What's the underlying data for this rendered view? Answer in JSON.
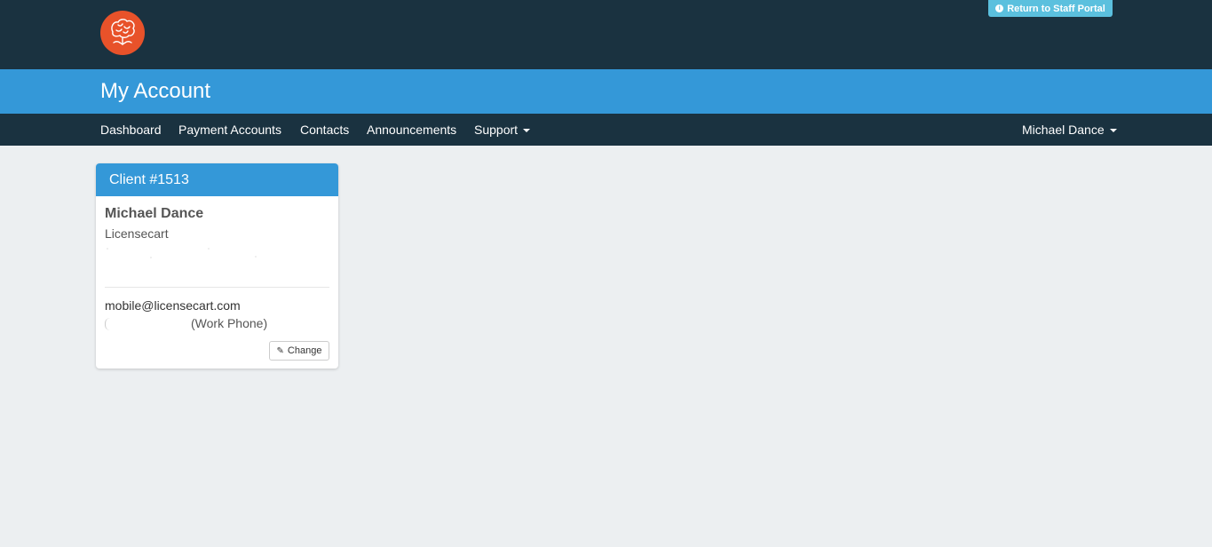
{
  "header": {
    "staff_portal_label": "Return to Staff Portal",
    "logo_icon": "brain-logo",
    "brand_color": "#e8522a"
  },
  "title": "My Account",
  "nav": {
    "items": [
      {
        "label": "Dashboard"
      },
      {
        "label": "Payment Accounts"
      },
      {
        "label": "Contacts"
      },
      {
        "label": "Announcements"
      },
      {
        "label": "Support"
      }
    ],
    "user_menu": "Michael Dance"
  },
  "client_card": {
    "header": "Client #1513",
    "name": "Michael Dance",
    "company": "Licensecart",
    "email": "mobile@licensecart.com",
    "phone_label": "(Work Phone)",
    "change_label": "Change"
  },
  "colors": {
    "topbar": "#1a3240",
    "accent": "#3498d8",
    "info": "#5bc0de",
    "background": "#eceff1"
  }
}
